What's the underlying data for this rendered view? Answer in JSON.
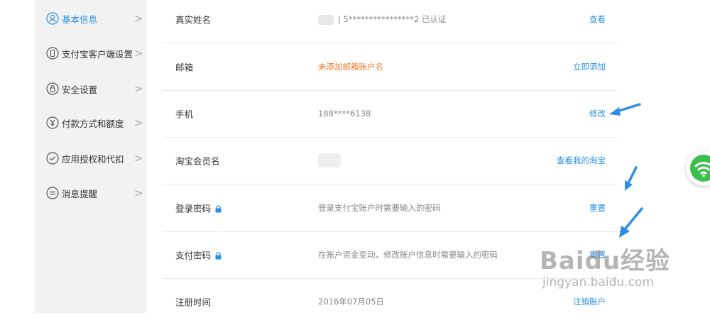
{
  "sidebar": {
    "items": [
      {
        "label": "基本信息",
        "icon": "user-icon"
      },
      {
        "label": "支付宝客户端设置",
        "icon": "phone-icon"
      },
      {
        "label": "安全设置",
        "icon": "lock-icon"
      },
      {
        "label": "付款方式和额度",
        "icon": "yuan-icon"
      },
      {
        "label": "应用授权和代扣",
        "icon": "check-icon"
      },
      {
        "label": "消息提醒",
        "icon": "message-icon"
      }
    ],
    "chevron": ">"
  },
  "profile": {
    "rows": [
      {
        "label": "真实姓名",
        "value": "| 5****************2 已认证",
        "action": "查看"
      },
      {
        "label": "邮箱",
        "value": "未添加邮箱账户名",
        "action": "立即添加"
      },
      {
        "label": "手机",
        "value": "188****6138",
        "action": "修改"
      },
      {
        "label": "淘宝会员名",
        "value": "",
        "action": "查看我的淘宝"
      },
      {
        "label": "登录密码",
        "value": "登录支付宝账户时需要输入的密码",
        "action": "重置"
      },
      {
        "label": "支付密码",
        "value": "在账户资金变动，修改账户信息时需要输入的密码",
        "action": "重置"
      },
      {
        "label": "注册时间",
        "value": "2016年07月05日",
        "action": "注销账户"
      }
    ]
  },
  "watermark": {
    "main": "Baidu经验",
    "sub": "jingyan.baidu.com"
  },
  "colors": {
    "accent": "#2a8fe0",
    "warning": "#f07a2b",
    "arrow": "#2f8ee5",
    "wifi": "#3bbf4a"
  }
}
